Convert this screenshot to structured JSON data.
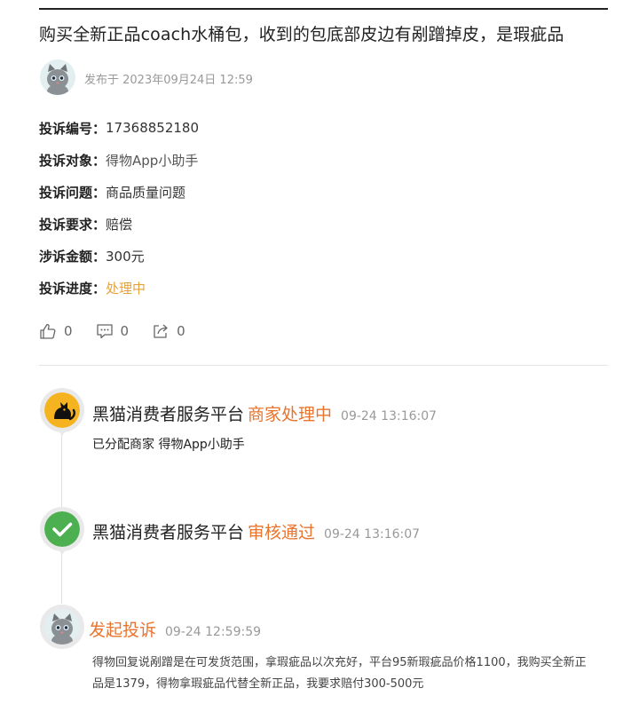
{
  "complaint": {
    "title": "购买全新正品coach水桶包，收到的包底部皮边有剐蹭掉皮，是瑕疵品",
    "posted_at": "发布于 2023年09月24日 12:59",
    "fields": [
      {
        "label": "投诉编号：",
        "value": "17368852180"
      },
      {
        "label": "投诉对象：",
        "value": "得物App小助手"
      },
      {
        "label": "投诉问题：",
        "value": "商品质量问题"
      },
      {
        "label": "投诉要求：",
        "value": "赔偿"
      },
      {
        "label": "涉诉金额：",
        "value": "300元"
      },
      {
        "label": "投诉进度：",
        "value": "处理中"
      }
    ],
    "status_color": "#e6a23c"
  },
  "actions": {
    "like_count": "0",
    "comment_count": "0",
    "share_count": "0"
  },
  "timeline": [
    {
      "actor": "黑猫消费者服务平台",
      "status": "商家处理中",
      "time": "09-24 13:16:07",
      "detail": "已分配商家 得物App小助手",
      "icon": "black-cat-logo"
    },
    {
      "actor": "黑猫消费者服务平台",
      "status": "审核通过",
      "time": "09-24 13:16:07",
      "icon": "check-icon"
    },
    {
      "actor": "",
      "status": "发起投诉",
      "time": "09-24 12:59:59",
      "detail": "得物回复说剐蹭是在可发货范围，拿瑕疵品以次充好，平台95新瑕疵品价格1100，我购买全新正品是1379，得物拿瑕疵品代替全新正品，我要求赔付300-500元",
      "icon": "cat-avatar"
    }
  ],
  "colors": {
    "accent_orange": "#e8742e",
    "check_green": "#4caf50",
    "progress_yellow": "#e6a23c"
  }
}
